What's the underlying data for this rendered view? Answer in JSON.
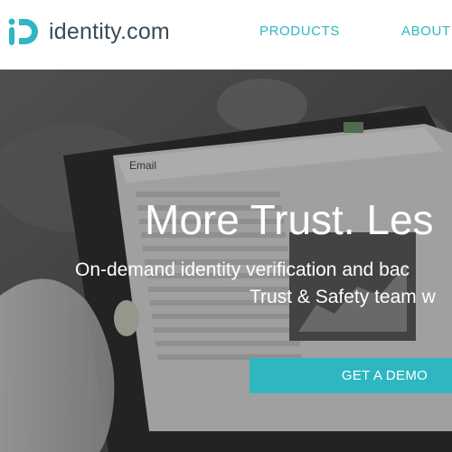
{
  "brand": {
    "name": "identity",
    "suffix": ".com",
    "accent": "#2fb7c1",
    "text_color": "#3b4a55"
  },
  "nav": {
    "items": [
      {
        "label": "PRODUCTS"
      },
      {
        "label": "ABOUT"
      }
    ]
  },
  "hero": {
    "headline": "More Trust. Les",
    "subline_1": "On-demand identity verification and bac",
    "subline_2": "Trust & Safety team w",
    "cta_label": "GET A DEMO",
    "tablet_screen_title": "Email"
  }
}
